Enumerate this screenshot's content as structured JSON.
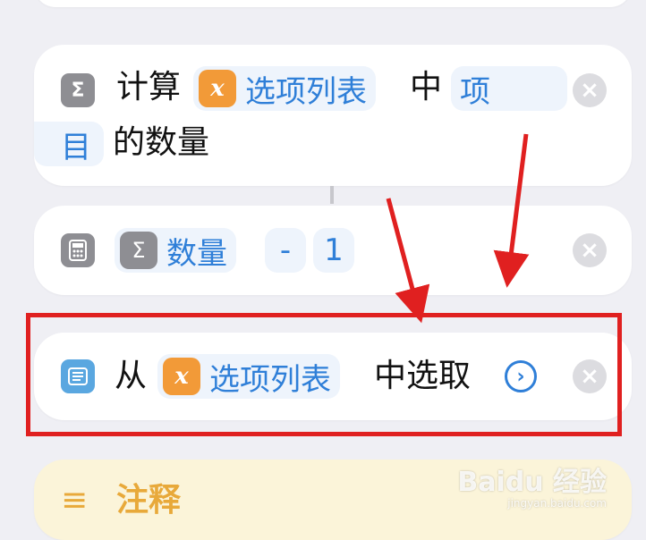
{
  "actions": {
    "count": {
      "prefix": "计算",
      "variable": "选项列表",
      "middle": "中",
      "token_line1": "项",
      "token_line2": "目",
      "suffix": "的数量",
      "icon": "sigma-icon"
    },
    "calculate": {
      "token": "数量",
      "operator": "-",
      "operand": "1",
      "icon": "calculator-icon"
    },
    "pick": {
      "prefix": "从",
      "variable": "选项列表",
      "suffix": "中选取",
      "icon": "list-icon"
    },
    "note": {
      "title": "注释",
      "icon": "menu-lines-icon"
    }
  },
  "glyphs": {
    "sigma": "Σ",
    "variable_x": "x",
    "close": "×",
    "chevron": "›",
    "menu": "≡"
  },
  "watermark": {
    "brand": "Baidu 经验",
    "url": "jingyan.baidu.com"
  },
  "colors": {
    "accent_blue": "#2f7fd8",
    "variable_orange": "#f29a38",
    "highlight_red": "#e02020",
    "note_yellow": "#fbf4d9"
  }
}
